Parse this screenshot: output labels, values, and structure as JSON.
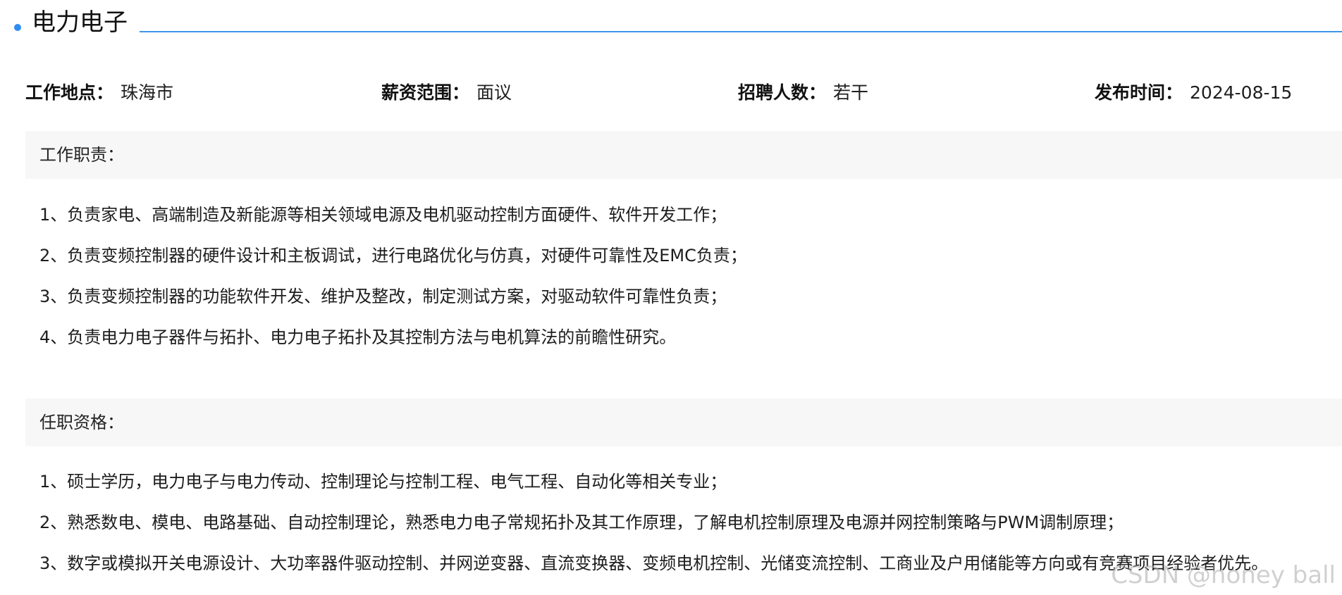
{
  "header": {
    "title": "电力电子"
  },
  "meta": {
    "location_label": "工作地点：",
    "location_value": "珠海市",
    "salary_label": "薪资范围：",
    "salary_value": "面议",
    "headcount_label": "招聘人数：",
    "headcount_value": "若干",
    "publish_label": "发布时间：",
    "publish_value": "2024-08-15"
  },
  "sections": {
    "duties": {
      "title": "工作职责：",
      "items": [
        "1、负责家电、高端制造及新能源等相关领域电源及电机驱动控制方面硬件、软件开发工作；",
        "2、负责变频控制器的硬件设计和主板调试，进行电路优化与仿真，对硬件可靠性及EMC负责；",
        "3、负责变频控制器的功能软件开发、维护及整改，制定测试方案，对驱动软件可靠性负责；",
        "4、负责电力电子器件与拓扑、电力电子拓扑及其控制方法与电机算法的前瞻性研究。"
      ]
    },
    "qualifications": {
      "title": "任职资格：",
      "items": [
        "1、硕士学历，电力电子与电力传动、控制理论与控制工程、电气工程、自动化等相关专业；",
        "2、熟悉数电、模电、电路基础、自动控制理论，熟悉电力电子常规拓扑及其工作原理，了解电机控制原理及电源并网控制策略与PWM调制原理；",
        "3、数字或模拟开关电源设计、大功率器件驱动控制、并网逆变器、直流变换器、变频电机控制、光储变流控制、工商业及户用储能等方向或有竞赛项目经验者优先。"
      ]
    }
  },
  "watermark": "CSDN @honey ball",
  "colors": {
    "accent": "#3d95e8",
    "section_bg": "#f7f7f7",
    "text": "#1f1f1f"
  }
}
